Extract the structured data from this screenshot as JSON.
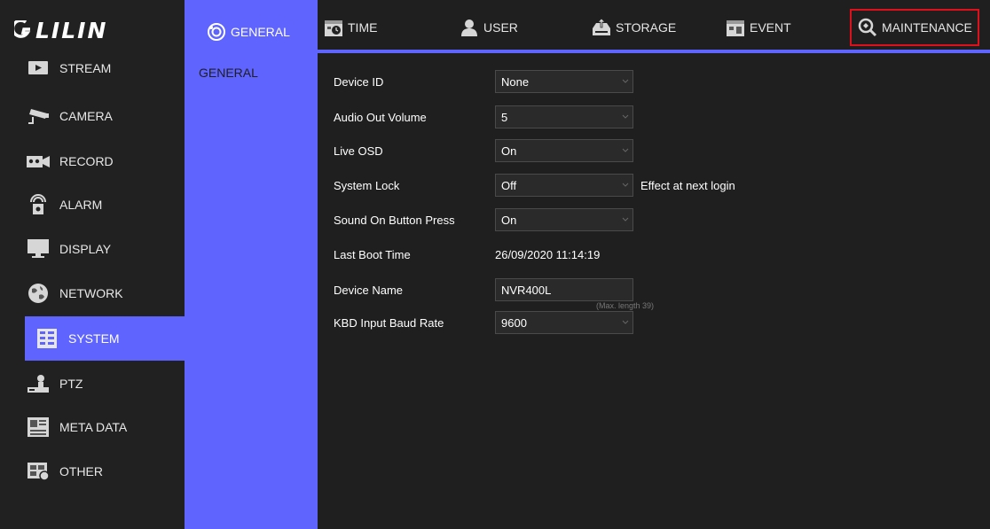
{
  "brand": {
    "logo_text": "LILIN",
    "accent": "#5f64ff",
    "highlight": "#e0101a"
  },
  "sidebar": {
    "items": [
      {
        "label": "STREAM",
        "icon": "stream-icon"
      },
      {
        "label": "CAMERA",
        "icon": "camera-icon"
      },
      {
        "label": "RECORD",
        "icon": "record-icon"
      },
      {
        "label": "ALARM",
        "icon": "alarm-icon"
      },
      {
        "label": "DISPLAY",
        "icon": "display-icon"
      },
      {
        "label": "NETWORK",
        "icon": "network-icon"
      },
      {
        "label": "SYSTEM",
        "icon": "system-icon",
        "active": true
      },
      {
        "label": "PTZ",
        "icon": "ptz-icon"
      },
      {
        "label": "META DATA",
        "icon": "metadata-icon"
      },
      {
        "label": "OTHER",
        "icon": "other-icon"
      }
    ]
  },
  "tabs": [
    {
      "label": "GENERAL",
      "icon": "gear-icon",
      "active": true
    },
    {
      "label": "TIME",
      "icon": "calendar-clock-icon"
    },
    {
      "label": "USER",
      "icon": "user-icon"
    },
    {
      "label": "STORAGE",
      "icon": "storage-icon"
    },
    {
      "label": "EVENT",
      "icon": "event-icon"
    },
    {
      "label": "MAINTENANCE",
      "icon": "maintenance-icon",
      "highlighted": true
    }
  ],
  "subnav": {
    "items": [
      {
        "label": "GENERAL"
      }
    ]
  },
  "form": {
    "device_id": {
      "label": "Device ID",
      "value": "None"
    },
    "audio_out_volume": {
      "label": "Audio Out Volume",
      "value": "5"
    },
    "live_osd": {
      "label": "Live OSD",
      "value": "On"
    },
    "system_lock": {
      "label": "System Lock",
      "value": "Off",
      "note": "Effect at next login"
    },
    "sound_on_button_press": {
      "label": "Sound On Button Press",
      "value": "On"
    },
    "last_boot_time": {
      "label": "Last Boot Time",
      "value": "26/09/2020 11:14:19"
    },
    "device_name": {
      "label": "Device Name",
      "value": "NVR400L",
      "hint": "(Max. length 39)"
    },
    "kbd_input_baud_rate": {
      "label": "KBD Input Baud Rate",
      "value": "9600"
    }
  }
}
